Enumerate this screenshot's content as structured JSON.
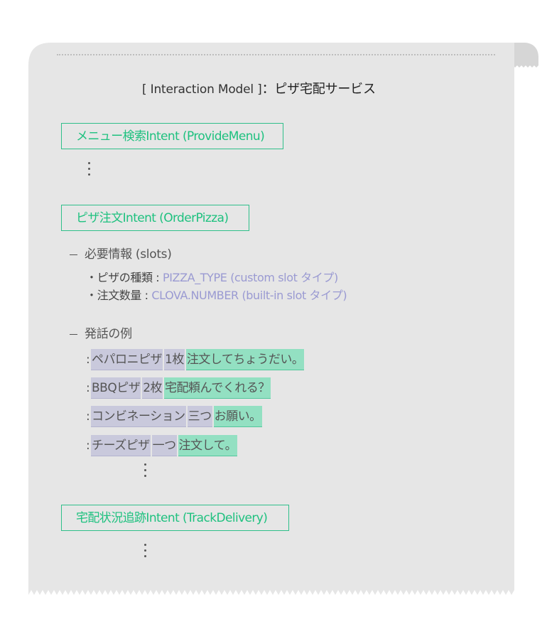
{
  "title": {
    "bracket": "[ Interaction Model ]",
    "colon": "：",
    "service": "ピザ宅配サービス"
  },
  "intents": [
    {
      "label": "メニュー検索Intent (ProvideMenu)"
    },
    {
      "label": "ピザ注文Intent (OrderPizza)"
    },
    {
      "label": "宅配状況追跡Intent (TrackDelivery)"
    }
  ],
  "slots_section": {
    "heading": "必要情報 (slots)",
    "items": [
      {
        "name": "・ピザの種類 : ",
        "type": "PIZZA_TYPE (custom slot タイプ)"
      },
      {
        "name": "・注文数量 : ",
        "type": "CLOVA.NUMBER (built-in slot タイプ)"
      }
    ]
  },
  "examples_section": {
    "heading": "発話の例",
    "colon": ":",
    "utterances": [
      {
        "slot1": "ペパロニピザ",
        "slot2": "1枚",
        "carrier": "注文してちょうだい。"
      },
      {
        "slot1": "BBQピザ",
        "slot2": "2枚",
        "carrier": "宅配頼んでくれる？"
      },
      {
        "slot1": "コンビネーション",
        "slot2": "三つ",
        "carrier": "お願い。"
      },
      {
        "slot1": "チーズピザ",
        "slot2": "一つ",
        "carrier": "注文して。"
      }
    ]
  },
  "colors": {
    "paper": "#e6e6e6",
    "intent_green": "#1ec17f",
    "slot_highlight": "#c9c9dc",
    "carrier_highlight": "#93e0c2",
    "slot_type_text": "#9a9ad2"
  }
}
